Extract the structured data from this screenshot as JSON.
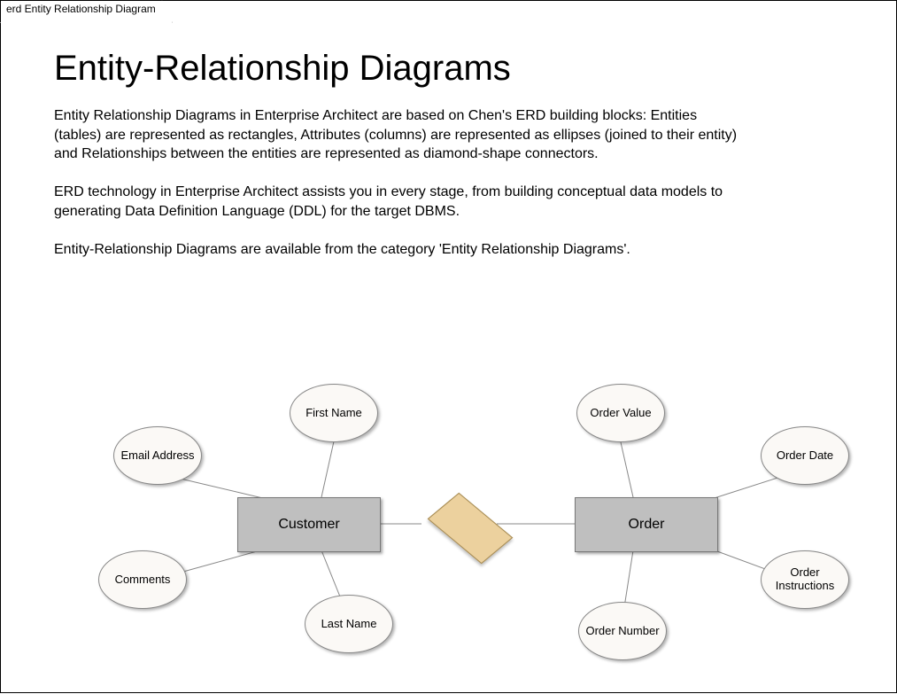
{
  "frame": {
    "tab_label": "erd Entity Relationship Diagram"
  },
  "header": {
    "title": "Entity-Relationship Diagrams",
    "description": "Entity Relationship Diagrams in Enterprise Architect are based on Chen's ERD building blocks: Entities (tables) are represented as rectangles, Attributes (columns) are represented as ellipses (joined to their entity) and Relationships between the entities are represented as diamond-shape connectors.\n\nERD technology in Enterprise Architect assists you in every stage, from building conceptual data models to generating Data Definition Language (DDL) for the target DBMS.\n\nEntity-Relationship Diagrams are available from the category 'Entity Relationship Diagrams'."
  },
  "diagram": {
    "entities": {
      "customer": "Customer",
      "order": "Order"
    },
    "relationship": {
      "customer_order": ""
    },
    "attributes": {
      "first_name": "First Name",
      "email_address": "Email Address",
      "comments": "Comments",
      "last_name": "Last Name",
      "order_value": "Order Value",
      "order_date": "Order Date",
      "order_instructions": "Order Instructions",
      "order_number": "Order Number"
    }
  }
}
